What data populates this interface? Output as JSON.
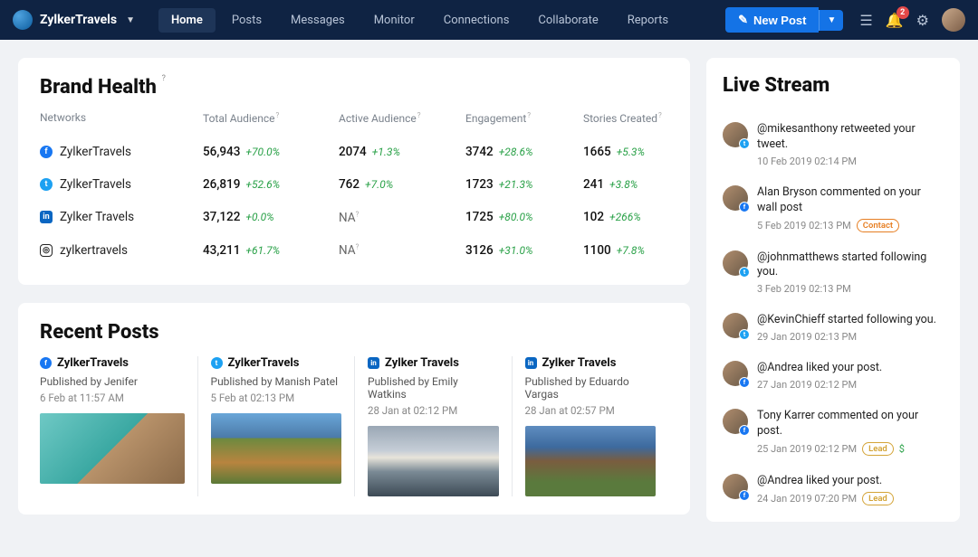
{
  "header": {
    "brand": "ZylkerTravels",
    "nav": [
      "Home",
      "Posts",
      "Messages",
      "Monitor",
      "Connections",
      "Collaborate",
      "Reports"
    ],
    "activeIndex": 0,
    "newPostLabel": "New Post",
    "notificationCount": "2"
  },
  "brandHealth": {
    "title": "Brand Health",
    "columns": [
      "Networks",
      "Total Audience",
      "Active Audience",
      "Engagement",
      "Stories Created"
    ],
    "rows": [
      {
        "icon": "fb",
        "name": "ZylkerTravels",
        "total": "56,943",
        "totalDelta": "+70.0%",
        "active": "2074",
        "activeDelta": "+1.3%",
        "eng": "3742",
        "engDelta": "+28.6%",
        "stories": "1665",
        "storiesDelta": "+5.3%"
      },
      {
        "icon": "tw",
        "name": "ZylkerTravels",
        "total": "26,819",
        "totalDelta": "+52.6%",
        "active": "762",
        "activeDelta": "+7.0%",
        "eng": "1723",
        "engDelta": "+21.3%",
        "stories": "241",
        "storiesDelta": "+3.8%"
      },
      {
        "icon": "li",
        "name": "Zylker Travels",
        "total": "37,122",
        "totalDelta": "+0.0%",
        "active": "NA",
        "activeDelta": "",
        "eng": "1725",
        "engDelta": "+80.0%",
        "stories": "102",
        "storiesDelta": "+266%"
      },
      {
        "icon": "ig",
        "name": "zylkertravels",
        "total": "43,211",
        "totalDelta": "+61.7%",
        "active": "NA",
        "activeDelta": "",
        "eng": "3126",
        "engDelta": "+31.0%",
        "stories": "1100",
        "storiesDelta": "+7.8%"
      }
    ]
  },
  "recentPosts": {
    "title": "Recent Posts",
    "items": [
      {
        "icon": "fb",
        "source": "ZylkerTravels",
        "publisher": "Published by Jenifer",
        "date": "6 Feb at 11:57 AM",
        "img": "img1"
      },
      {
        "icon": "tw",
        "source": "ZylkerTravels",
        "publisher": "Published by Manish Patel",
        "date": "5 Feb at 02:13 PM",
        "img": "img2"
      },
      {
        "icon": "li",
        "source": "Zylker Travels",
        "publisher": "Published by Emily Watkins",
        "date": "28 Jan at 02:12 PM",
        "img": "img3"
      },
      {
        "icon": "li",
        "source": "Zylker Travels",
        "publisher": "Published by Eduardo Vargas",
        "date": "28 Jan at 02:57 PM",
        "img": "img4"
      }
    ]
  },
  "liveStream": {
    "title": "Live Stream",
    "items": [
      {
        "badge": "tw",
        "text": "@mikesanthony retweeted your tweet.",
        "date": "10 Feb 2019 02:14 PM",
        "tag": ""
      },
      {
        "badge": "fb",
        "text": "Alan Bryson commented on your wall post",
        "date": "5 Feb 2019 02:13 PM",
        "tag": "Contact"
      },
      {
        "badge": "tw",
        "text": "@johnmatthews started following you.",
        "date": "3 Feb 2019 02:13 PM",
        "tag": ""
      },
      {
        "badge": "tw",
        "text": "@KevinChieff started following you.",
        "date": "29 Jan 2019 02:13 PM",
        "tag": ""
      },
      {
        "badge": "fb",
        "text": "@Andrea liked your post.",
        "date": "27 Jan 2019 02:12 PM",
        "tag": ""
      },
      {
        "badge": "fb",
        "text": "Tony Karrer commented on your post.",
        "date": "25 Jan 2019 02:12 PM",
        "tag": "Lead",
        "leadIcon": true
      },
      {
        "badge": "fb",
        "text": "@Andrea liked your post.",
        "date": "24 Jan 2019 07:20 PM",
        "tag": "Lead"
      }
    ]
  }
}
